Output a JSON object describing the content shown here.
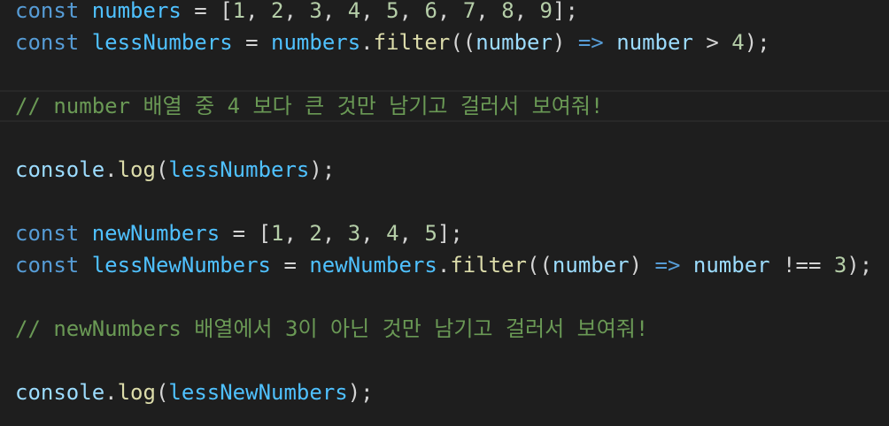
{
  "editor": {
    "lines": [
      {
        "tokens": [
          {
            "t": "kw",
            "v": "const"
          },
          {
            "t": "op",
            "v": " "
          },
          {
            "t": "var",
            "v": "numbers"
          },
          {
            "t": "op",
            "v": " = "
          },
          {
            "t": "punct",
            "v": "["
          },
          {
            "t": "num",
            "v": "1"
          },
          {
            "t": "op",
            "v": ", "
          },
          {
            "t": "num",
            "v": "2"
          },
          {
            "t": "op",
            "v": ", "
          },
          {
            "t": "num",
            "v": "3"
          },
          {
            "t": "op",
            "v": ", "
          },
          {
            "t": "num",
            "v": "4"
          },
          {
            "t": "op",
            "v": ", "
          },
          {
            "t": "num",
            "v": "5"
          },
          {
            "t": "op",
            "v": ", "
          },
          {
            "t": "num",
            "v": "6"
          },
          {
            "t": "op",
            "v": ", "
          },
          {
            "t": "num",
            "v": "7"
          },
          {
            "t": "op",
            "v": ", "
          },
          {
            "t": "num",
            "v": "8"
          },
          {
            "t": "op",
            "v": ", "
          },
          {
            "t": "num",
            "v": "9"
          },
          {
            "t": "punct",
            "v": "];"
          }
        ]
      },
      {
        "tokens": [
          {
            "t": "kw",
            "v": "const"
          },
          {
            "t": "op",
            "v": " "
          },
          {
            "t": "var",
            "v": "lessNumbers"
          },
          {
            "t": "op",
            "v": " = "
          },
          {
            "t": "var",
            "v": "numbers"
          },
          {
            "t": "op",
            "v": "."
          },
          {
            "t": "fn",
            "v": "filter"
          },
          {
            "t": "punct",
            "v": "(("
          },
          {
            "t": "param",
            "v": "number"
          },
          {
            "t": "punct",
            "v": ")"
          },
          {
            "t": "op",
            "v": " "
          },
          {
            "t": "kw",
            "v": "=>"
          },
          {
            "t": "op",
            "v": " "
          },
          {
            "t": "param",
            "v": "number"
          },
          {
            "t": "op",
            "v": " > "
          },
          {
            "t": "num",
            "v": "4"
          },
          {
            "t": "punct",
            "v": ");"
          }
        ]
      },
      {
        "tokens": []
      },
      {
        "current": true,
        "tokens": [
          {
            "t": "cmt",
            "v": "// number 배열 중 4 보다 큰 것만 남기고 걸러서 보여줘!"
          }
        ]
      },
      {
        "tokens": []
      },
      {
        "tokens": [
          {
            "t": "param",
            "v": "console"
          },
          {
            "t": "op",
            "v": "."
          },
          {
            "t": "fn",
            "v": "log"
          },
          {
            "t": "punct",
            "v": "("
          },
          {
            "t": "var",
            "v": "lessNumbers"
          },
          {
            "t": "punct",
            "v": ");"
          }
        ]
      },
      {
        "tokens": []
      },
      {
        "tokens": [
          {
            "t": "kw",
            "v": "const"
          },
          {
            "t": "op",
            "v": " "
          },
          {
            "t": "var",
            "v": "newNumbers"
          },
          {
            "t": "op",
            "v": " = "
          },
          {
            "t": "punct",
            "v": "["
          },
          {
            "t": "num",
            "v": "1"
          },
          {
            "t": "op",
            "v": ", "
          },
          {
            "t": "num",
            "v": "2"
          },
          {
            "t": "op",
            "v": ", "
          },
          {
            "t": "num",
            "v": "3"
          },
          {
            "t": "op",
            "v": ", "
          },
          {
            "t": "num",
            "v": "4"
          },
          {
            "t": "op",
            "v": ", "
          },
          {
            "t": "num",
            "v": "5"
          },
          {
            "t": "punct",
            "v": "];"
          }
        ]
      },
      {
        "tokens": [
          {
            "t": "kw",
            "v": "const"
          },
          {
            "t": "op",
            "v": " "
          },
          {
            "t": "var",
            "v": "lessNewNumbers"
          },
          {
            "t": "op",
            "v": " = "
          },
          {
            "t": "var",
            "v": "newNumbers"
          },
          {
            "t": "op",
            "v": "."
          },
          {
            "t": "fn",
            "v": "filter"
          },
          {
            "t": "punct",
            "v": "(("
          },
          {
            "t": "param",
            "v": "number"
          },
          {
            "t": "punct",
            "v": ")"
          },
          {
            "t": "op",
            "v": " "
          },
          {
            "t": "kw",
            "v": "=>"
          },
          {
            "t": "op",
            "v": " "
          },
          {
            "t": "param",
            "v": "number"
          },
          {
            "t": "op",
            "v": " !== "
          },
          {
            "t": "num",
            "v": "3"
          },
          {
            "t": "punct",
            "v": ");"
          }
        ]
      },
      {
        "tokens": []
      },
      {
        "tokens": [
          {
            "t": "cmt",
            "v": "// newNumbers 배열에서 3이 아닌 것만 남기고 걸러서 보여줘!"
          }
        ]
      },
      {
        "tokens": []
      },
      {
        "tokens": [
          {
            "t": "param",
            "v": "console"
          },
          {
            "t": "op",
            "v": "."
          },
          {
            "t": "fn",
            "v": "log"
          },
          {
            "t": "punct",
            "v": "("
          },
          {
            "t": "var",
            "v": "lessNewNumbers"
          },
          {
            "t": "punct",
            "v": ");"
          }
        ]
      }
    ]
  }
}
